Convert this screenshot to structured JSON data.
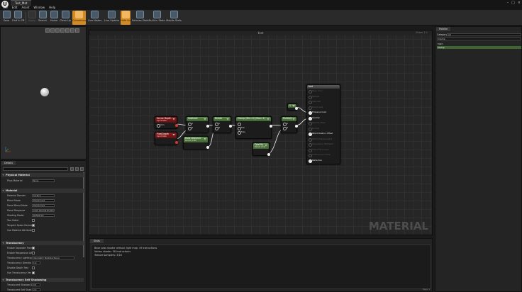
{
  "window": {
    "tab_title": "Test_Mat",
    "logo_glyph": "U",
    "menu": [
      "File",
      "Edit",
      "Asset",
      "Window",
      "Help"
    ],
    "controls": [
      "–",
      "□",
      "×"
    ]
  },
  "toolbar": {
    "buttons": [
      {
        "label": "Save",
        "icon": "save-icon"
      },
      {
        "label": "Find in CB",
        "icon": "find-in-content-browser-icon"
      },
      {
        "label": "Apply",
        "icon": "apply-icon",
        "disabled": true
      },
      {
        "label": "Search",
        "icon": "search-icon"
      },
      {
        "label": "Home",
        "icon": "home-icon"
      },
      {
        "label": "Clean Up",
        "icon": "clean-up-icon"
      },
      {
        "label": "Connectors",
        "icon": "connectors-icon",
        "active": true
      },
      {
        "label": "Live Nodes",
        "icon": "live-nodes-icon"
      },
      {
        "label": "Live Update",
        "icon": "live-update-icon"
      },
      {
        "label": "Hide Unrelated",
        "icon": "hide-unrelated-icon",
        "active": true
      },
      {
        "label": "Release Stats",
        "icon": "release-stats-icon"
      },
      {
        "label": "Built-in Stats",
        "icon": "built-in-stats-icon"
      },
      {
        "label": "Mobile Stats",
        "icon": "mobile-stats-icon"
      }
    ]
  },
  "details": {
    "tab": "Details",
    "sections": {
      "physical_material": "Physical Material",
      "material": "Material",
      "translucency": "Translucency",
      "translucency_self_shadowing": "Translucency Self Shadowing"
    },
    "props": {
      "phys_material": {
        "label": "Phys Material",
        "value": "None"
      },
      "material_domain": {
        "label": "Material Domain",
        "value": "Surface"
      },
      "blend_mode": {
        "label": "Blend Mode",
        "value": "Translucent"
      },
      "decal_blend_mode": {
        "label": "Decal Blend Mode",
        "value": "Translucent"
      },
      "shading_model": {
        "label": "Shading Model",
        "value": "Default Lit"
      },
      "decal_response": {
        "label": "Decal Response",
        "value": "Color Normal Roughness"
      },
      "two_sided": {
        "label": "Two Sided"
      },
      "tangent_space_normal": {
        "label": "Tangent Space Normal"
      },
      "use_material_attributes": {
        "label": "Use Material Attributes"
      },
      "enable_separate_translucency": {
        "label": "Enable Separate Transl"
      },
      "enable_responsive_aa": {
        "label": "Enable Responsive AA"
      },
      "translucency_lighting": {
        "label": "Translucency Lighting",
        "value": "Volumetric NonDirectional"
      },
      "translucency_directional": {
        "label": "Translucency Directio",
        "value": "1.0"
      },
      "disable_depth_test": {
        "label": "Disable Depth Test"
      },
      "use_translucency_vertex_fog": {
        "label": "Use Translucency Ver"
      },
      "translucent_shadow_density": {
        "label": "Translucent Shadow D",
        "value": "0.5"
      },
      "translucent_self_shadow": {
        "label": "Translucent Self Shad",
        "value": "2.0"
      }
    }
  },
  "graph": {
    "title": "test",
    "zoom": "Zoom 1:1",
    "watermark": "MATERIAL",
    "nodes": {
      "scene_depth": {
        "title": "Scene Depth",
        "subtitle": "Input Data",
        "pins": [
          "UVs"
        ]
      },
      "pixel_depth": {
        "title": "PixelDepth",
        "subtitle": "Input Data"
      },
      "subtract": {
        "title": "Subtract",
        "pins": [
          "A",
          "B"
        ]
      },
      "fade_distance": {
        "title": "Fade Distance",
        "subtitle": "Param (100)"
      },
      "divide": {
        "title": "Divide",
        "pins": [
          "A",
          "B"
        ]
      },
      "clamp": {
        "title": "Clamp (Min=0) (Max=1)",
        "pins": [
          "",
          "Min",
          "Max"
        ]
      },
      "opacity": {
        "title": "Opacity",
        "subtitle": "Param (0.5)"
      },
      "multiply": {
        "title": "Multiply",
        "pins": [
          "A",
          "B"
        ]
      },
      "constant": {
        "title": "1"
      },
      "result": {
        "title": "test",
        "inputs": [
          {
            "label": "Base Color",
            "on": false
          },
          {
            "label": "Metallic",
            "on": false
          },
          {
            "label": "Specular",
            "on": false
          },
          {
            "label": "Roughness",
            "on": false
          },
          {
            "label": "Emissive Color",
            "on": true
          },
          {
            "label": "Opacity",
            "on": true
          },
          {
            "label": "Opacity Mask",
            "on": false
          },
          {
            "label": "Normal",
            "on": false
          },
          {
            "label": "World Position Offset",
            "on": true
          },
          {
            "label": "World Displacement",
            "on": false
          },
          {
            "label": "Tessellation Multiplier",
            "on": false
          },
          {
            "label": "Subsurface Color",
            "on": false
          },
          {
            "label": "Ambient Occlusion",
            "on": false
          },
          {
            "label": "Refraction",
            "on": true
          }
        ]
      }
    }
  },
  "palette": {
    "tab": "Palette",
    "category_label": "Category",
    "category_value": "All",
    "search_value": "Clamp",
    "item": "Math",
    "selected": "Clamp"
  },
  "stats": {
    "tab": "Stats",
    "lines": [
      "Base pass shader without light map: 39 instructions",
      "Vertex shader: 36 instructions",
      "Texture samplers: 3/16"
    ],
    "page": "Page 1"
  }
}
